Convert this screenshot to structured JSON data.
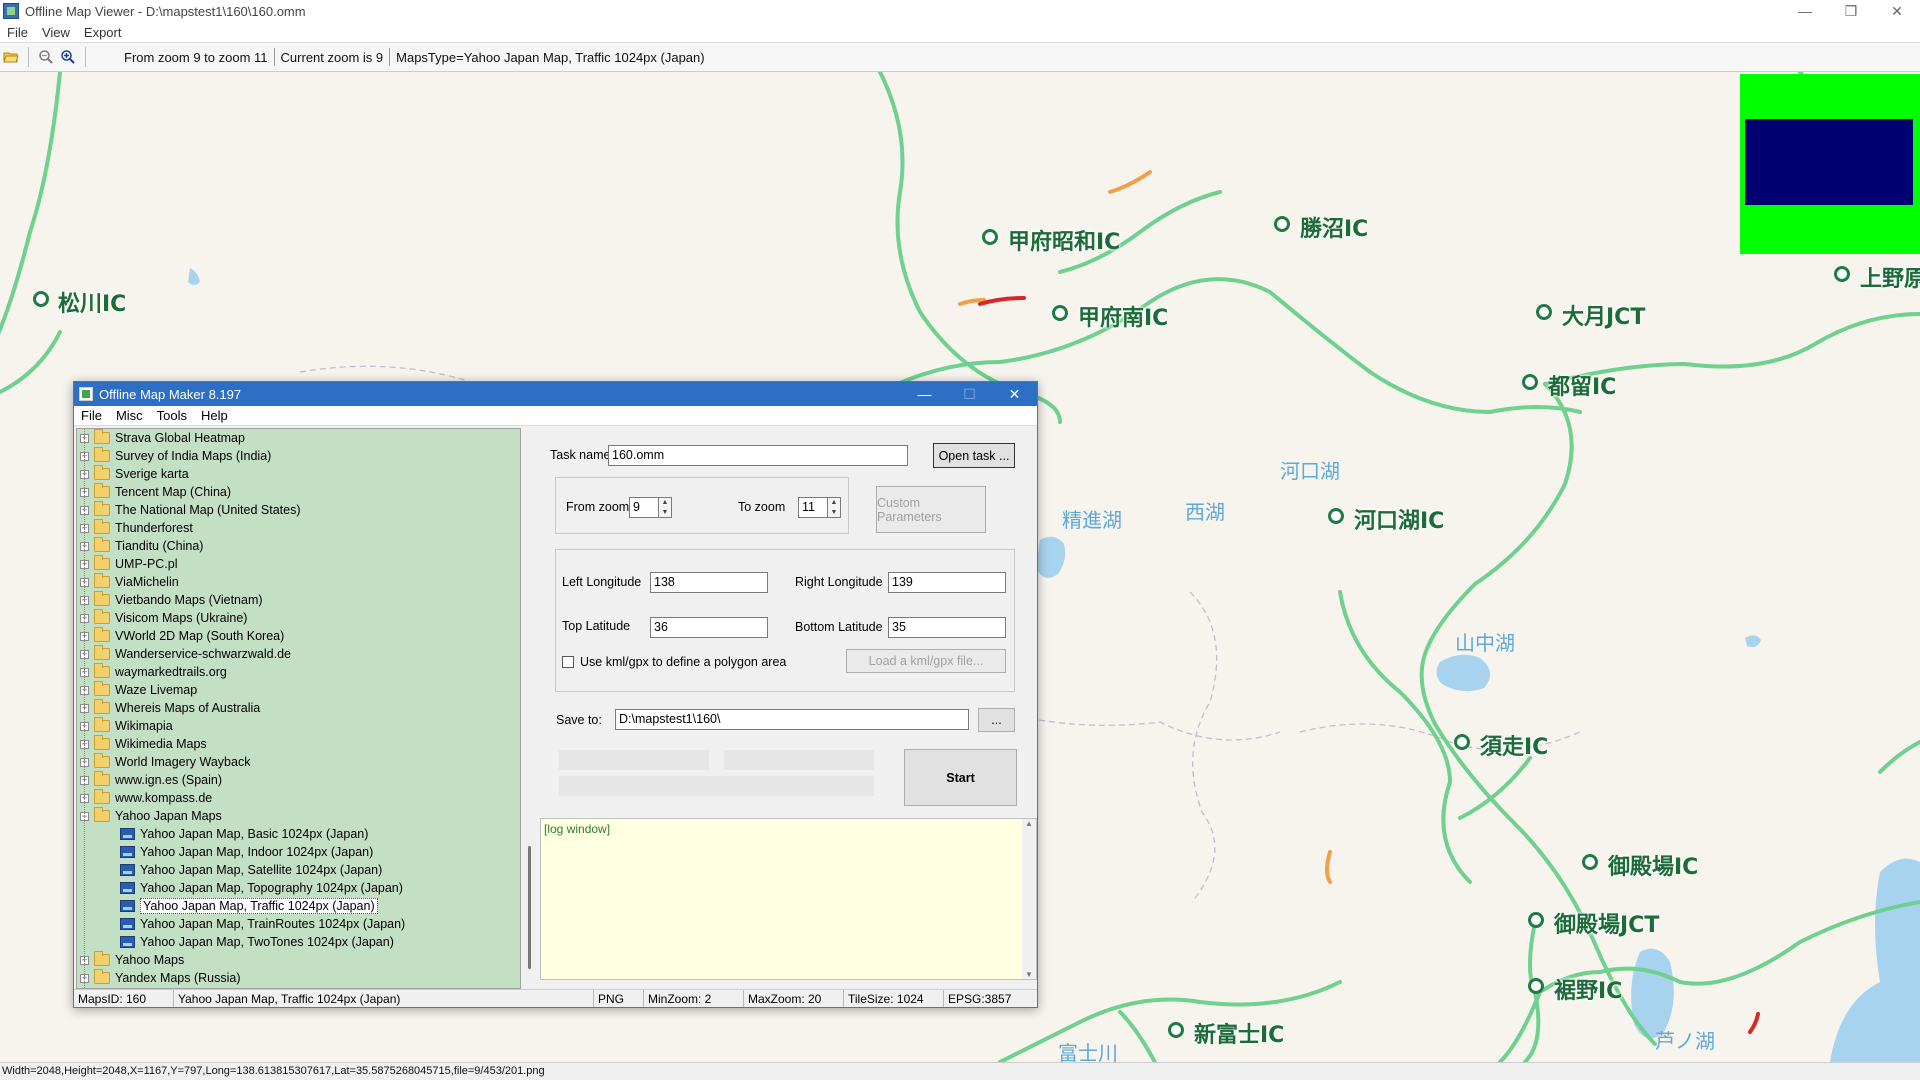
{
  "window": {
    "title": "Offline Map Viewer - D:\\mapstest1\\160\\160.omm",
    "minimize": "—",
    "restore": "❐",
    "close": "✕"
  },
  "menu": [
    "File",
    "View",
    "Export"
  ],
  "toolbar": {
    "zoom_range": "From zoom 9 to zoom 11",
    "current_zoom": "Current zoom is 9",
    "maps_type": "MapsType=Yahoo Japan Map, Traffic 1024px (Japan)"
  },
  "map": {
    "ic_labels": [
      "松川IC",
      "甲府昭和IC",
      "勝沼IC",
      "甲府南IC",
      "大月JCT",
      "上野原",
      "都留IC",
      "河口湖IC",
      "須走IC",
      "御殿場IC",
      "御殿場JCT",
      "裾野IC",
      "新富士IC"
    ],
    "lake_labels": [
      "河口湖",
      "精進湖",
      "西湖",
      "山中湖",
      "富士川",
      "芦ノ湖"
    ],
    "overlay_colors": {
      "outer": "#00ff00",
      "inner": "#000070"
    }
  },
  "statusbar": "Width=2048,Height=2048,X=1167,Y=797,Long=138.613815307617,Lat=35.5875268045715,file=9/453/201.png",
  "dialog": {
    "title": "Offline Map Maker 8.197",
    "menu": [
      "File",
      "Misc",
      "Tools",
      "Help"
    ],
    "tree": {
      "providers_before": [
        "Strava Global Heatmap",
        "Survey of India Maps (India)",
        "Sverige karta",
        "Tencent Map (China)",
        "The National Map (United States)",
        "Thunderforest",
        "Tianditu (China)",
        "UMP-PC.pl",
        "ViaMichelin",
        "Vietbando Maps (Vietnam)",
        "Visicom Maps (Ukraine)",
        "VWorld 2D Map (South Korea)",
        "Wanderservice-schwarzwald.de",
        "waymarkedtrails.org",
        "Waze Livemap",
        "Whereis Maps of Australia",
        "Wikimapia",
        "Wikimedia Maps",
        "World Imagery Wayback",
        "www.ign.es (Spain)",
        "www.kompass.de"
      ],
      "expanded": "Yahoo Japan Maps",
      "children": [
        "Yahoo Japan Map, Basic 1024px (Japan)",
        "Yahoo Japan Map, Indoor 1024px (Japan)",
        "Yahoo Japan Map, Satellite 1024px (Japan)",
        "Yahoo Japan Map, Topography 1024px (Japan)",
        "Yahoo Japan Map, Traffic 1024px (Japan)",
        "Yahoo Japan Map, TrainRoutes 1024px (Japan)",
        "Yahoo Japan Map, TwoTones 1024px (Japan)"
      ],
      "selected_index": 4,
      "providers_after": [
        "Yahoo Maps",
        "Yandex Maps (Russia)"
      ]
    },
    "form": {
      "task_name_label": "Task name",
      "task_name": "160.omm",
      "open_task": "Open task ...",
      "from_zoom_label": "From zoom",
      "from_zoom": "9",
      "to_zoom_label": "To zoom",
      "to_zoom": "11",
      "custom_params": "Custom Parameters",
      "left_lon_label": "Left Longitude",
      "left_lon": "138",
      "right_lon_label": "Right Longitude",
      "right_lon": "139",
      "top_lat_label": "Top Latitude",
      "top_lat": "36",
      "bottom_lat_label": "Bottom Latitude",
      "bottom_lat": "35",
      "kml_checkbox": "Use kml/gpx to define a polygon area",
      "load_kml": "Load a kml/gpx file...",
      "save_to_label": "Save to:",
      "save_to": "D:\\mapstest1\\160\\",
      "browse": "...",
      "start": "Start",
      "log": "[log window]"
    },
    "status": {
      "maps_id": "MapsID: 160",
      "map_name": "Yahoo Japan Map, Traffic 1024px (Japan)",
      "format": "PNG",
      "min_zoom": "MinZoom: 2",
      "max_zoom": "MaxZoom: 20",
      "tile_size": "TileSize: 1024",
      "epsg": "EPSG:3857"
    }
  }
}
